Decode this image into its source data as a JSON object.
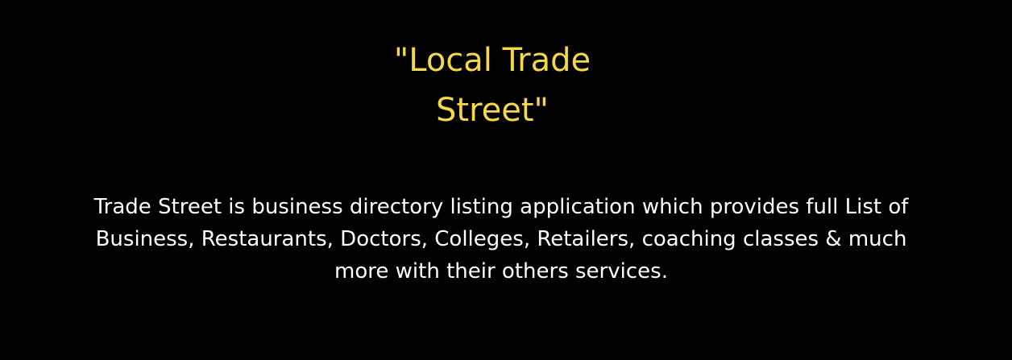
{
  "title": {
    "line1": "\"Local Trade",
    "line2": "Street\""
  },
  "description": {
    "line1": "Trade Street is business directory listing application which provides full List of",
    "line2": "Business, Restaurants, Doctors, Colleges, Retailers, coaching classes & much",
    "line3": "more with their others services."
  },
  "colors": {
    "background": "#000000",
    "title": "#f5d84a",
    "description": "#ffffff"
  }
}
